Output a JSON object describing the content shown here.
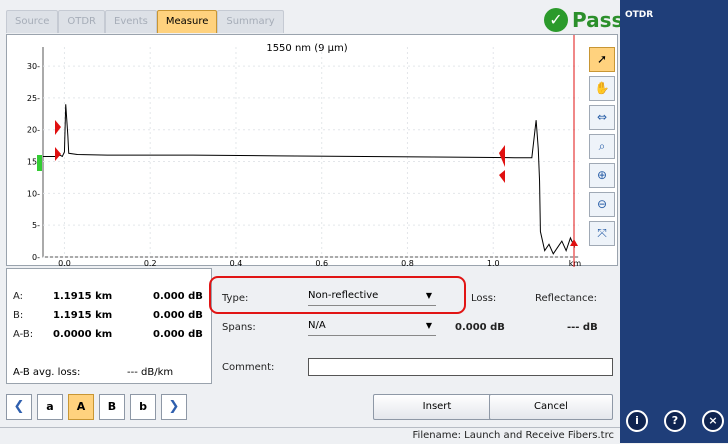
{
  "tabs": [
    {
      "label": "Source",
      "active": false
    },
    {
      "label": "OTDR",
      "active": false
    },
    {
      "label": "Events",
      "active": false
    },
    {
      "label": "Measure",
      "active": true
    },
    {
      "label": "Summary",
      "active": false
    }
  ],
  "status": {
    "label": "Pass",
    "color": "#2b9a2b"
  },
  "graph": {
    "title": "1550 nm (9 µm)",
    "x_unit": "km",
    "x_ticks": [
      "0.0",
      "0.2",
      "0.4",
      "0.6",
      "0.8",
      "1.0"
    ],
    "y_ticks": [
      "0",
      "5",
      "10",
      "15",
      "20",
      "25",
      "30"
    ],
    "trace_color": "#000000",
    "marker_color": "#e01010"
  },
  "chart_data": {
    "type": "line",
    "title": "1550 nm (9 µm)",
    "xlabel": "km",
    "ylabel": "",
    "xlim": [
      -0.05,
      1.2
    ],
    "ylim": [
      0,
      33
    ],
    "series": [
      {
        "x": [
          -0.05,
          -0.02,
          -0.01,
          -0.005,
          0.0,
          0.003,
          0.008,
          0.01,
          0.03,
          0.1,
          0.3,
          0.5,
          0.7,
          0.9,
          1.05,
          1.09,
          1.1,
          1.105,
          1.108,
          1.11,
          1.12,
          1.13,
          1.14,
          1.15,
          1.16,
          1.17,
          1.18,
          1.19
        ],
        "y": [
          15.8,
          15.8,
          16.0,
          15.8,
          16.5,
          24.0,
          19.0,
          16.3,
          16.1,
          16.0,
          16.0,
          15.9,
          15.8,
          15.7,
          15.6,
          15.6,
          21.5,
          17.0,
          12.0,
          4.0,
          1.0,
          2.0,
          0.5,
          1.5,
          2.5,
          1.0,
          3.0,
          1.5
        ]
      }
    ],
    "markers": [
      "A",
      "B",
      "a",
      "b"
    ]
  },
  "tools": [
    "pointer-icon",
    "hand-icon",
    "zoom-fit-icon",
    "zoom-region-icon",
    "zoom-in-icon",
    "zoom-out-icon",
    "reset-zoom-icon"
  ],
  "info": {
    "a_label": "A:",
    "a_dist": "1.1915 km",
    "a_db": "0.000 dB",
    "b_label": "B:",
    "b_dist": "1.1915 km",
    "b_db": "0.000 dB",
    "ab_label": "A-B:",
    "ab_dist": "0.0000 km",
    "ab_db": "0.000 dB",
    "avg_label": "A-B avg. loss:",
    "avg_val": "--- dB/km"
  },
  "nav": {
    "prev": "❮",
    "a_lower": "a",
    "a_upper": "A",
    "b_upper": "B",
    "b_lower": "b",
    "next": "❯"
  },
  "form": {
    "type_label": "Type:",
    "type_value": "Non-reflective",
    "spans_label": "Spans:",
    "spans_value": "N/A",
    "loss_label": "Loss:",
    "loss_value": "0.000 dB",
    "refl_label": "Reflectance:",
    "refl_value": "--- dB",
    "comment_label": "Comment:",
    "comment_value": ""
  },
  "buttons": {
    "insert": "Insert",
    "cancel": "Cancel"
  },
  "filename": "Filename: Launch and Receive Fibers.trc",
  "right_panel": {
    "title": "OTDR",
    "buttons": [
      "i",
      "?",
      "×"
    ]
  }
}
